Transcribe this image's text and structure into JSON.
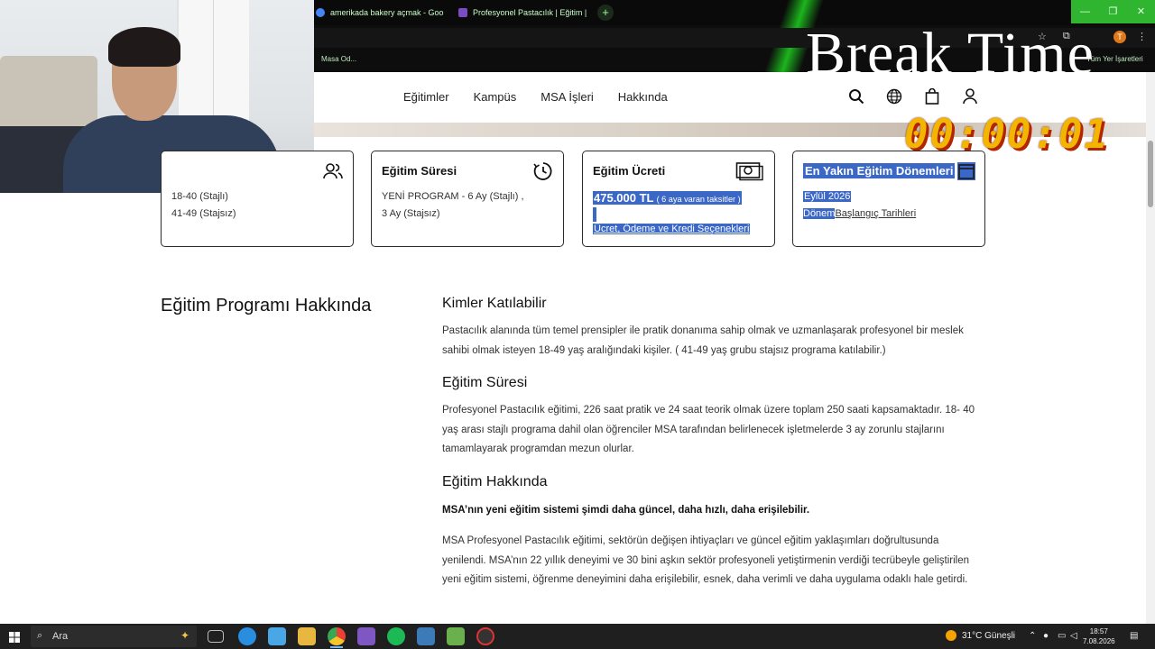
{
  "browser": {
    "tabs": [
      {
        "title": "amerikada bakery açmak - Goo",
        "favicon_color": "#4285f4"
      },
      {
        "title": "Profesyonel Pastacılık | Eğitim |",
        "favicon_color": "#7b4bc4"
      }
    ],
    "bookmark_text": "Masa Od...",
    "bookmark_text_right": "Tüm Yer İşaretleri",
    "profile_initial": "T",
    "window_buttons": [
      "—",
      "❐",
      "✕"
    ]
  },
  "overlay": {
    "break_text": "Break Time",
    "timer": "00:00:01"
  },
  "site_nav": {
    "links": [
      "Eğitimler",
      "Kampüs",
      "MSA İşleri",
      "Hakkında"
    ]
  },
  "cards": [
    {
      "title": "",
      "lines": [
        "18-40 (Stajlı)",
        "41-49 (Stajsız)"
      ],
      "icon": "users-icon"
    },
    {
      "title": "Eğitim Süresi",
      "lines": [
        "YENİ PROGRAM - 6 Ay (Stajlı) ,",
        "3 Ay (Stajsız)"
      ],
      "icon": "clock-icon"
    },
    {
      "title": "Eğitim Ücreti",
      "price": "475.000 TL",
      "price_note": "( 6 aya varan taksitler )",
      "link": "Ücret, Ödeme ve Kredi Seçenekleri",
      "icon": "money-icon"
    },
    {
      "title": "En Yakın Eğitim Dönemleri",
      "lines": [
        "Eylül 2026"
      ],
      "link_prefix": "Dönem",
      "link": "Başlangıç Tarihleri",
      "icon": "calendar-icon"
    }
  ],
  "content": {
    "section_title": "Eğitim Programı Hakkında",
    "h_who": "Kimler Katılabilir",
    "p_who": "Pastacılık alanında tüm temel prensipler ile pratik donanıma sahip olmak ve uzmanlaşarak profesyonel bir meslek sahibi olmak isteyen 18-49 yaş aralığındaki kişiler. ( 41-49 yaş grubu stajsız programa katılabilir.)",
    "h_duration": "Eğitim Süresi",
    "p_duration": "Profesyonel Pastacılık eğitimi, 226 saat pratik ve 24 saat teorik olmak üzere toplam 250 saati kapsamaktadır. 18- 40 yaş arası stajlı programa dahil olan öğrenciler MSA tarafından belirlenecek işletmelerde 3 ay zorunlu stajlarını tamamlayarak programdan mezun olurlar.",
    "h_about": "Eğitim Hakkında",
    "p_about_bold": "MSA’nın yeni eğitim sistemi şimdi daha güncel, daha hızlı, daha erişilebilir.",
    "p_about": "MSA Profesyonel Pastacılık eğitimi, sektörün değişen ihtiyaçları ve güncel eğitim yaklaşımları doğrultusunda yenilendi. MSA’nın 22 yıllık deneyimi ve 30 bini aşkın sektör profesyoneli yetiştirmenin verdiği tecrübeyle geliştirilen yeni eğitim sistemi, öğrenme deneyimini daha erişilebilir, esnek, daha verimli ve daha uygulama odaklı hale getirdi."
  },
  "taskbar": {
    "search_placeholder": "Ara",
    "weather": "31°C  Güneşli",
    "time": "18:57",
    "date": "7.08.2026"
  },
  "colors": {
    "selection": "#3b67c7",
    "timer": "#f2b500",
    "window_buttons": "#2fb52f"
  }
}
